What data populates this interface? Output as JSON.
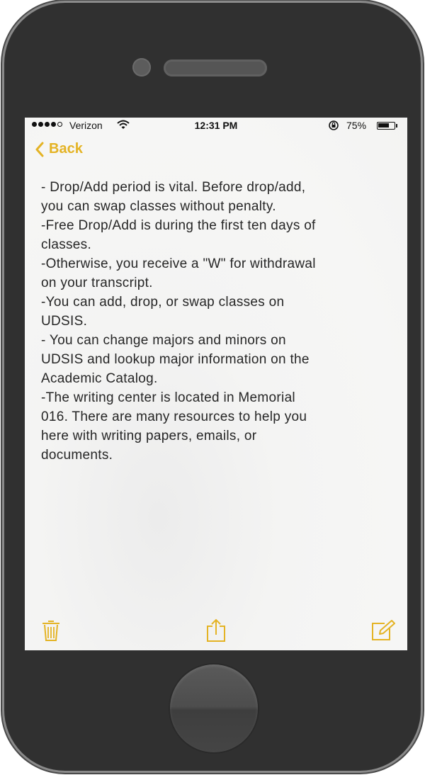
{
  "status_bar": {
    "carrier": "Verizon",
    "time": "12:31 PM",
    "battery_percent": "75%",
    "battery_level": 0.75,
    "signal_bars_filled": 4,
    "signal_bars_total": 5
  },
  "nav": {
    "back_label": "Back"
  },
  "note": {
    "text": "- Drop/Add period is vital. Before drop/add,\nyou can swap classes without penalty.\n-Free Drop/Add is during the first ten days of\nclasses.\n-Otherwise, you receive a \"W\" for withdrawal\non your transcript.\n-You can add, drop, or swap classes on\nUDSIS.\n- You can change majors and minors on\nUDSIS and lookup major information on the\nAcademic Catalog.\n-The writing center is located in Memorial\n016. There are many resources to help you\nhere with writing papers, emails, or\ndocuments."
  },
  "toolbar": {
    "icons": [
      "trash-icon",
      "share-icon",
      "compose-icon"
    ]
  },
  "colors": {
    "accent": "#e4b324",
    "phone_body": "#303030",
    "note_background": "#f6f6f5",
    "text": "#262626"
  }
}
